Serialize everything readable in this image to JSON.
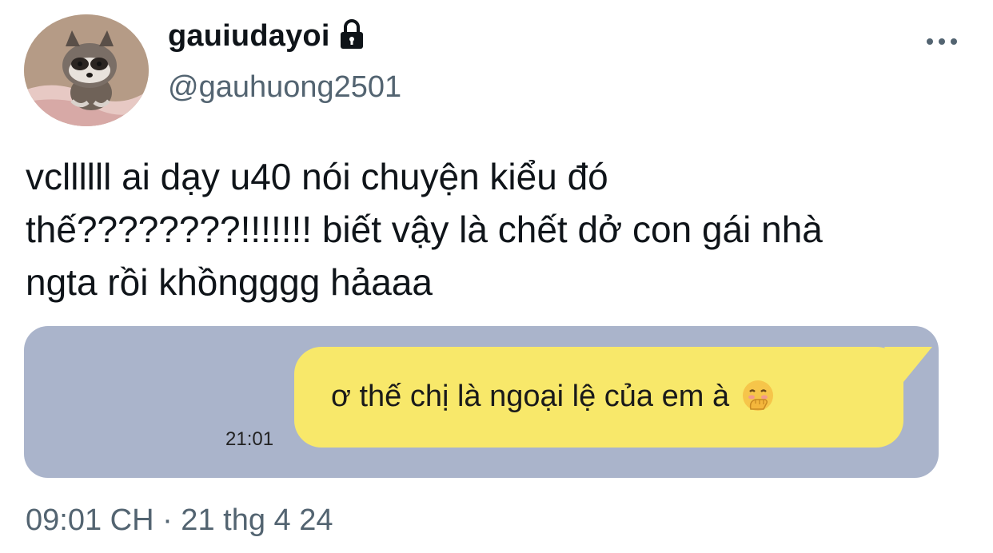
{
  "author": {
    "display_name": "gauiudayoi",
    "handle": "@gauhuong2501",
    "protected_icon": "lock-icon",
    "avatar": "raccoon-photo"
  },
  "menu": {
    "icon": "more-dots-icon"
  },
  "tweet": {
    "text": "vcllllll ai dạy u40 nói chuyện kiểu đó\nthế????????!!!!!!! biết vậy là chết dở con gái nhà\nngta rồi khồngggg hảaaa"
  },
  "media": {
    "message": "ơ thế chị là ngoại lệ của em à",
    "emoji": "hand-over-mouth-emoji",
    "time": "21:01",
    "colors": {
      "background": "#aab4cb",
      "bubble": "#f8e86a"
    }
  },
  "meta": {
    "timestamp": "09:01 CH · 21 thg 4 24"
  }
}
